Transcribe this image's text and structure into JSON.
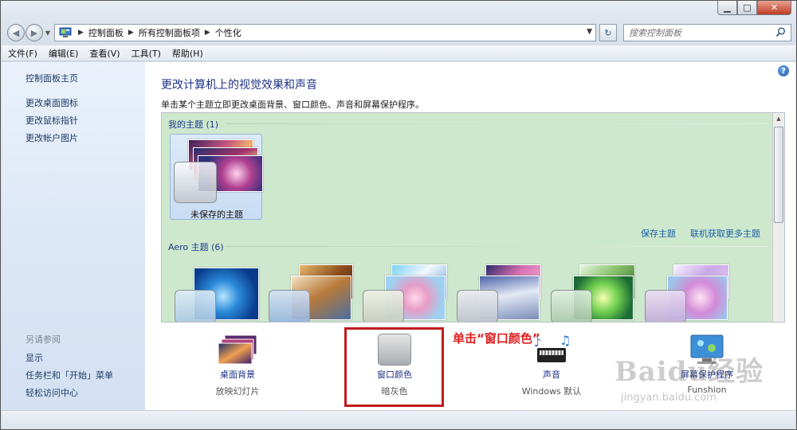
{
  "window": {
    "caption": {
      "minimize": "▁",
      "maximize": "□",
      "close": "✕"
    }
  },
  "nav": {
    "back_icon": "back-arrow-icon",
    "forward_icon": "forward-arrow-icon",
    "breadcrumbs": [
      "控制面板",
      "所有控制面板项",
      "个性化"
    ],
    "refresh_icon": "refresh-icon",
    "search_placeholder": "搜索控制面板"
  },
  "menu": [
    "文件(F)",
    "编辑(E)",
    "查看(V)",
    "工具(T)",
    "帮助(H)"
  ],
  "sidebar": {
    "home": "控制面板主页",
    "links": [
      "更改桌面图标",
      "更改鼠标指针",
      "更改帐户图片"
    ],
    "see_also_title": "另请参阅",
    "see_also": [
      "显示",
      "任务栏和「开始」菜单",
      "轻松访问中心"
    ]
  },
  "main": {
    "title": "更改计算机上的视觉效果和声音",
    "subtitle": "单击某个主题立即更改桌面背景、窗口颜色、声音和屏幕保护程序。",
    "my_themes_label": "我的主题 (1)",
    "unsaved_theme": "未保存的主题",
    "save_theme": "保存主题",
    "get_more": "联机获取更多主题",
    "aero_label": "Aero 主题 (6)"
  },
  "bottom": {
    "items": [
      {
        "label": "桌面背景",
        "sub": "放映幻灯片"
      },
      {
        "label": "窗口颜色",
        "sub": "暗灰色"
      },
      {
        "label": "声音",
        "sub": "Windows 默认"
      },
      {
        "label": "屏幕保护程序",
        "sub": "Funshion"
      }
    ],
    "annotation": "单击“窗口颜色”"
  },
  "watermark": {
    "logo": "Baidu经验",
    "url": "jingyan.baidu.com"
  },
  "colors": {
    "accent": "#1e3287",
    "link": "#1b5ea8",
    "annotation": "#e02020",
    "highlight_box": "#c11b1b",
    "themes_bg": "#cde8cd"
  }
}
